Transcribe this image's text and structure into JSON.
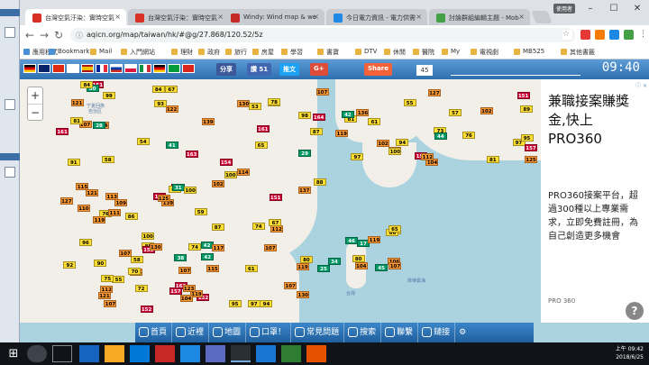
{
  "browser": {
    "tabs": [
      {
        "label": "台灣空氣汙染：實時空氣",
        "color": "#d93025",
        "active": true
      },
      {
        "label": "台灣空氣汙染：實時空氣",
        "color": "#d93025",
        "active": false
      },
      {
        "label": "Windy: Wind map & we",
        "color": "#c62828",
        "active": false
      },
      {
        "label": "今日電力資訊 - 電力供需",
        "color": "#1e88e5",
        "active": false
      },
      {
        "label": "討論群組編輯主題 - Mob",
        "color": "#43a047",
        "active": false
      }
    ],
    "user_chip": "使用者",
    "url": "aqicn.org/map/taiwan/hk/#@g/27.868/120.52/5z",
    "bookmarks": [
      "應用程式",
      "Bookmarks",
      "Mail",
      "入門網站",
      "理財",
      "政府",
      "旅行",
      "房屋",
      "學習",
      "書寶",
      "DTV",
      "休閒",
      "醫院",
      "My",
      "電視劇",
      "MB525"
    ],
    "other_bookmarks": "其他書籤"
  },
  "page": {
    "share_buttons": [
      {
        "label": "分享",
        "color": "#3b5998"
      },
      {
        "label": "讚 51",
        "color": "#4267b2"
      },
      {
        "label": "推文",
        "color": "#1da1f2"
      },
      {
        "label": "G+",
        "color": "#dd4b39"
      },
      {
        "label": "Share",
        "color": "#f4623a"
      }
    ],
    "share_count": "45",
    "clock": "09:40",
    "bottom_nav": [
      "首頁",
      "近裡",
      "地圖",
      "口罩！",
      "常見問題",
      "搜索",
      "聯繫",
      "鏈接"
    ],
    "map_labels": [
      "宁夏回族",
      "自治区",
      "台灣",
      "菲律賓海"
    ],
    "ad": {
      "tag": "ⓘ ✕",
      "headline": "兼職接案賺獎金,快上PRO360",
      "body": "PRO360接案平台，超過300種以上專業需求，立即免費註冊，為自己創造更多機會",
      "brand": "PRO 360",
      "help": "?"
    }
  },
  "markers": [
    {
      "v": "130",
      "c": "o"
    },
    {
      "v": "121",
      "c": "o"
    },
    {
      "v": "139",
      "c": "o"
    },
    {
      "v": "152",
      "c": "r"
    },
    {
      "v": "163",
      "c": "r"
    },
    {
      "v": "154",
      "c": "r"
    },
    {
      "v": "76",
      "c": "y"
    },
    {
      "v": "85",
      "c": "y"
    },
    {
      "v": "152",
      "c": "r"
    },
    {
      "v": "87",
      "c": "y"
    },
    {
      "v": "112",
      "c": "o"
    },
    {
      "v": "99",
      "c": "y"
    },
    {
      "v": "107",
      "c": "o"
    },
    {
      "v": "151",
      "c": "r"
    },
    {
      "v": "152",
      "c": "r"
    },
    {
      "v": "137",
      "c": "o"
    },
    {
      "v": "157",
      "c": "r"
    },
    {
      "v": "100",
      "c": "y"
    },
    {
      "v": "152",
      "c": "r"
    },
    {
      "v": "65",
      "c": "y"
    },
    {
      "v": "42",
      "c": "g"
    },
    {
      "v": "95",
      "c": "y"
    },
    {
      "v": "122",
      "c": "o"
    },
    {
      "v": "151",
      "c": "r"
    },
    {
      "v": "153",
      "c": "r"
    },
    {
      "v": "163",
      "c": "r"
    },
    {
      "v": "161",
      "c": "r"
    },
    {
      "v": "121",
      "c": "o"
    },
    {
      "v": "41",
      "c": "g"
    },
    {
      "v": "88",
      "c": "y"
    },
    {
      "v": "61",
      "c": "y"
    },
    {
      "v": "58",
      "c": "y"
    },
    {
      "v": "67",
      "c": "y"
    },
    {
      "v": "111",
      "c": "o"
    },
    {
      "v": "115",
      "c": "o"
    },
    {
      "v": "164",
      "c": "r"
    },
    {
      "v": "119",
      "c": "o"
    },
    {
      "v": "107",
      "c": "o"
    },
    {
      "v": "161",
      "c": "r"
    },
    {
      "v": "102",
      "c": "o"
    },
    {
      "v": "80",
      "c": "y"
    },
    {
      "v": "38",
      "c": "g"
    },
    {
      "v": "55",
      "c": "y"
    },
    {
      "v": "130",
      "c": "o"
    },
    {
      "v": "107",
      "c": "o"
    },
    {
      "v": "135",
      "c": "o"
    },
    {
      "v": "119",
      "c": "o"
    },
    {
      "v": "119",
      "c": "o"
    },
    {
      "v": "121",
      "c": "o"
    },
    {
      "v": "72",
      "c": "y"
    },
    {
      "v": "30",
      "c": "g"
    },
    {
      "v": "80",
      "c": "y"
    },
    {
      "v": "42",
      "c": "g"
    },
    {
      "v": "139",
      "c": "o"
    },
    {
      "v": "107",
      "c": "o"
    },
    {
      "v": "104",
      "c": "o"
    },
    {
      "v": "109",
      "c": "o"
    },
    {
      "v": "54",
      "c": "y"
    },
    {
      "v": "58",
      "c": "y"
    },
    {
      "v": "112",
      "c": "o"
    },
    {
      "v": "110",
      "c": "o"
    },
    {
      "v": "78",
      "c": "y"
    },
    {
      "v": "127",
      "c": "o"
    },
    {
      "v": "107",
      "c": "o"
    },
    {
      "v": "115",
      "c": "o"
    },
    {
      "v": "117",
      "c": "o"
    },
    {
      "v": "107",
      "c": "o"
    },
    {
      "v": "125",
      "c": "o"
    },
    {
      "v": "100",
      "c": "y"
    },
    {
      "v": "84",
      "c": "y"
    },
    {
      "v": "74",
      "c": "y"
    },
    {
      "v": "75",
      "c": "y"
    },
    {
      "v": "92",
      "c": "y"
    },
    {
      "v": "113",
      "c": "o"
    },
    {
      "v": "87",
      "c": "y"
    },
    {
      "v": "104",
      "c": "o"
    },
    {
      "v": "114",
      "c": "o"
    },
    {
      "v": "107",
      "c": "o"
    },
    {
      "v": "91",
      "c": "y"
    },
    {
      "v": "97",
      "c": "y"
    },
    {
      "v": "60",
      "c": "y"
    },
    {
      "v": "96",
      "c": "y"
    },
    {
      "v": "70",
      "c": "y"
    },
    {
      "v": "84",
      "c": "y"
    },
    {
      "v": "93",
      "c": "y"
    },
    {
      "v": "123",
      "c": "o"
    },
    {
      "v": "130",
      "c": "o"
    },
    {
      "v": "31",
      "c": "g"
    },
    {
      "v": "98",
      "c": "y"
    },
    {
      "v": "67",
      "c": "y"
    },
    {
      "v": "28",
      "c": "g"
    },
    {
      "v": "59",
      "c": "y"
    },
    {
      "v": "53",
      "c": "y"
    },
    {
      "v": "94",
      "c": "y"
    },
    {
      "v": "74",
      "c": "y"
    },
    {
      "v": "29",
      "c": "g"
    },
    {
      "v": "90",
      "c": "y"
    },
    {
      "v": "81",
      "c": "y"
    },
    {
      "v": "100",
      "c": "y"
    },
    {
      "v": "86",
      "c": "y"
    },
    {
      "v": "89",
      "c": "y"
    },
    {
      "v": "97",
      "c": "y"
    },
    {
      "v": "61",
      "c": "y"
    },
    {
      "v": "73",
      "c": "y"
    },
    {
      "v": "97",
      "c": "y"
    },
    {
      "v": "55",
      "c": "y"
    },
    {
      "v": "57",
      "c": "y"
    },
    {
      "v": "17",
      "c": "g"
    },
    {
      "v": "34",
      "c": "g"
    },
    {
      "v": "25",
      "c": "g"
    },
    {
      "v": "76",
      "c": "y"
    },
    {
      "v": "81",
      "c": "y"
    },
    {
      "v": "42",
      "c": "g"
    },
    {
      "v": "44",
      "c": "g"
    },
    {
      "v": "104",
      "c": "o"
    },
    {
      "v": "127",
      "c": "o"
    },
    {
      "v": "151",
      "c": "r"
    },
    {
      "v": "157",
      "c": "r"
    },
    {
      "v": "125",
      "c": "o"
    },
    {
      "v": "101",
      "c": "o"
    },
    {
      "v": "81",
      "c": "y"
    },
    {
      "v": "157",
      "c": "r"
    },
    {
      "v": "136",
      "c": "o"
    },
    {
      "v": "119",
      "c": "o"
    },
    {
      "v": "102",
      "c": "o"
    },
    {
      "v": "94",
      "c": "y"
    },
    {
      "v": "102",
      "c": "o"
    },
    {
      "v": "95",
      "c": "y"
    },
    {
      "v": "100",
      "c": "y"
    },
    {
      "v": "112",
      "c": "o"
    },
    {
      "v": "67",
      "c": "y"
    },
    {
      "v": "66",
      "c": "y"
    },
    {
      "v": "46",
      "c": "g"
    },
    {
      "v": "45",
      "c": "g"
    },
    {
      "v": "65",
      "c": "y"
    },
    {
      "v": "80",
      "c": "y"
    },
    {
      "v": "106",
      "c": "o"
    },
    {
      "v": "107",
      "c": "o"
    },
    {
      "v": "104",
      "c": "o"
    },
    {
      "v": "119",
      "c": "o"
    }
  ],
  "taskbar": {
    "time": "上午 09:42",
    "date": "2018/6/25"
  }
}
